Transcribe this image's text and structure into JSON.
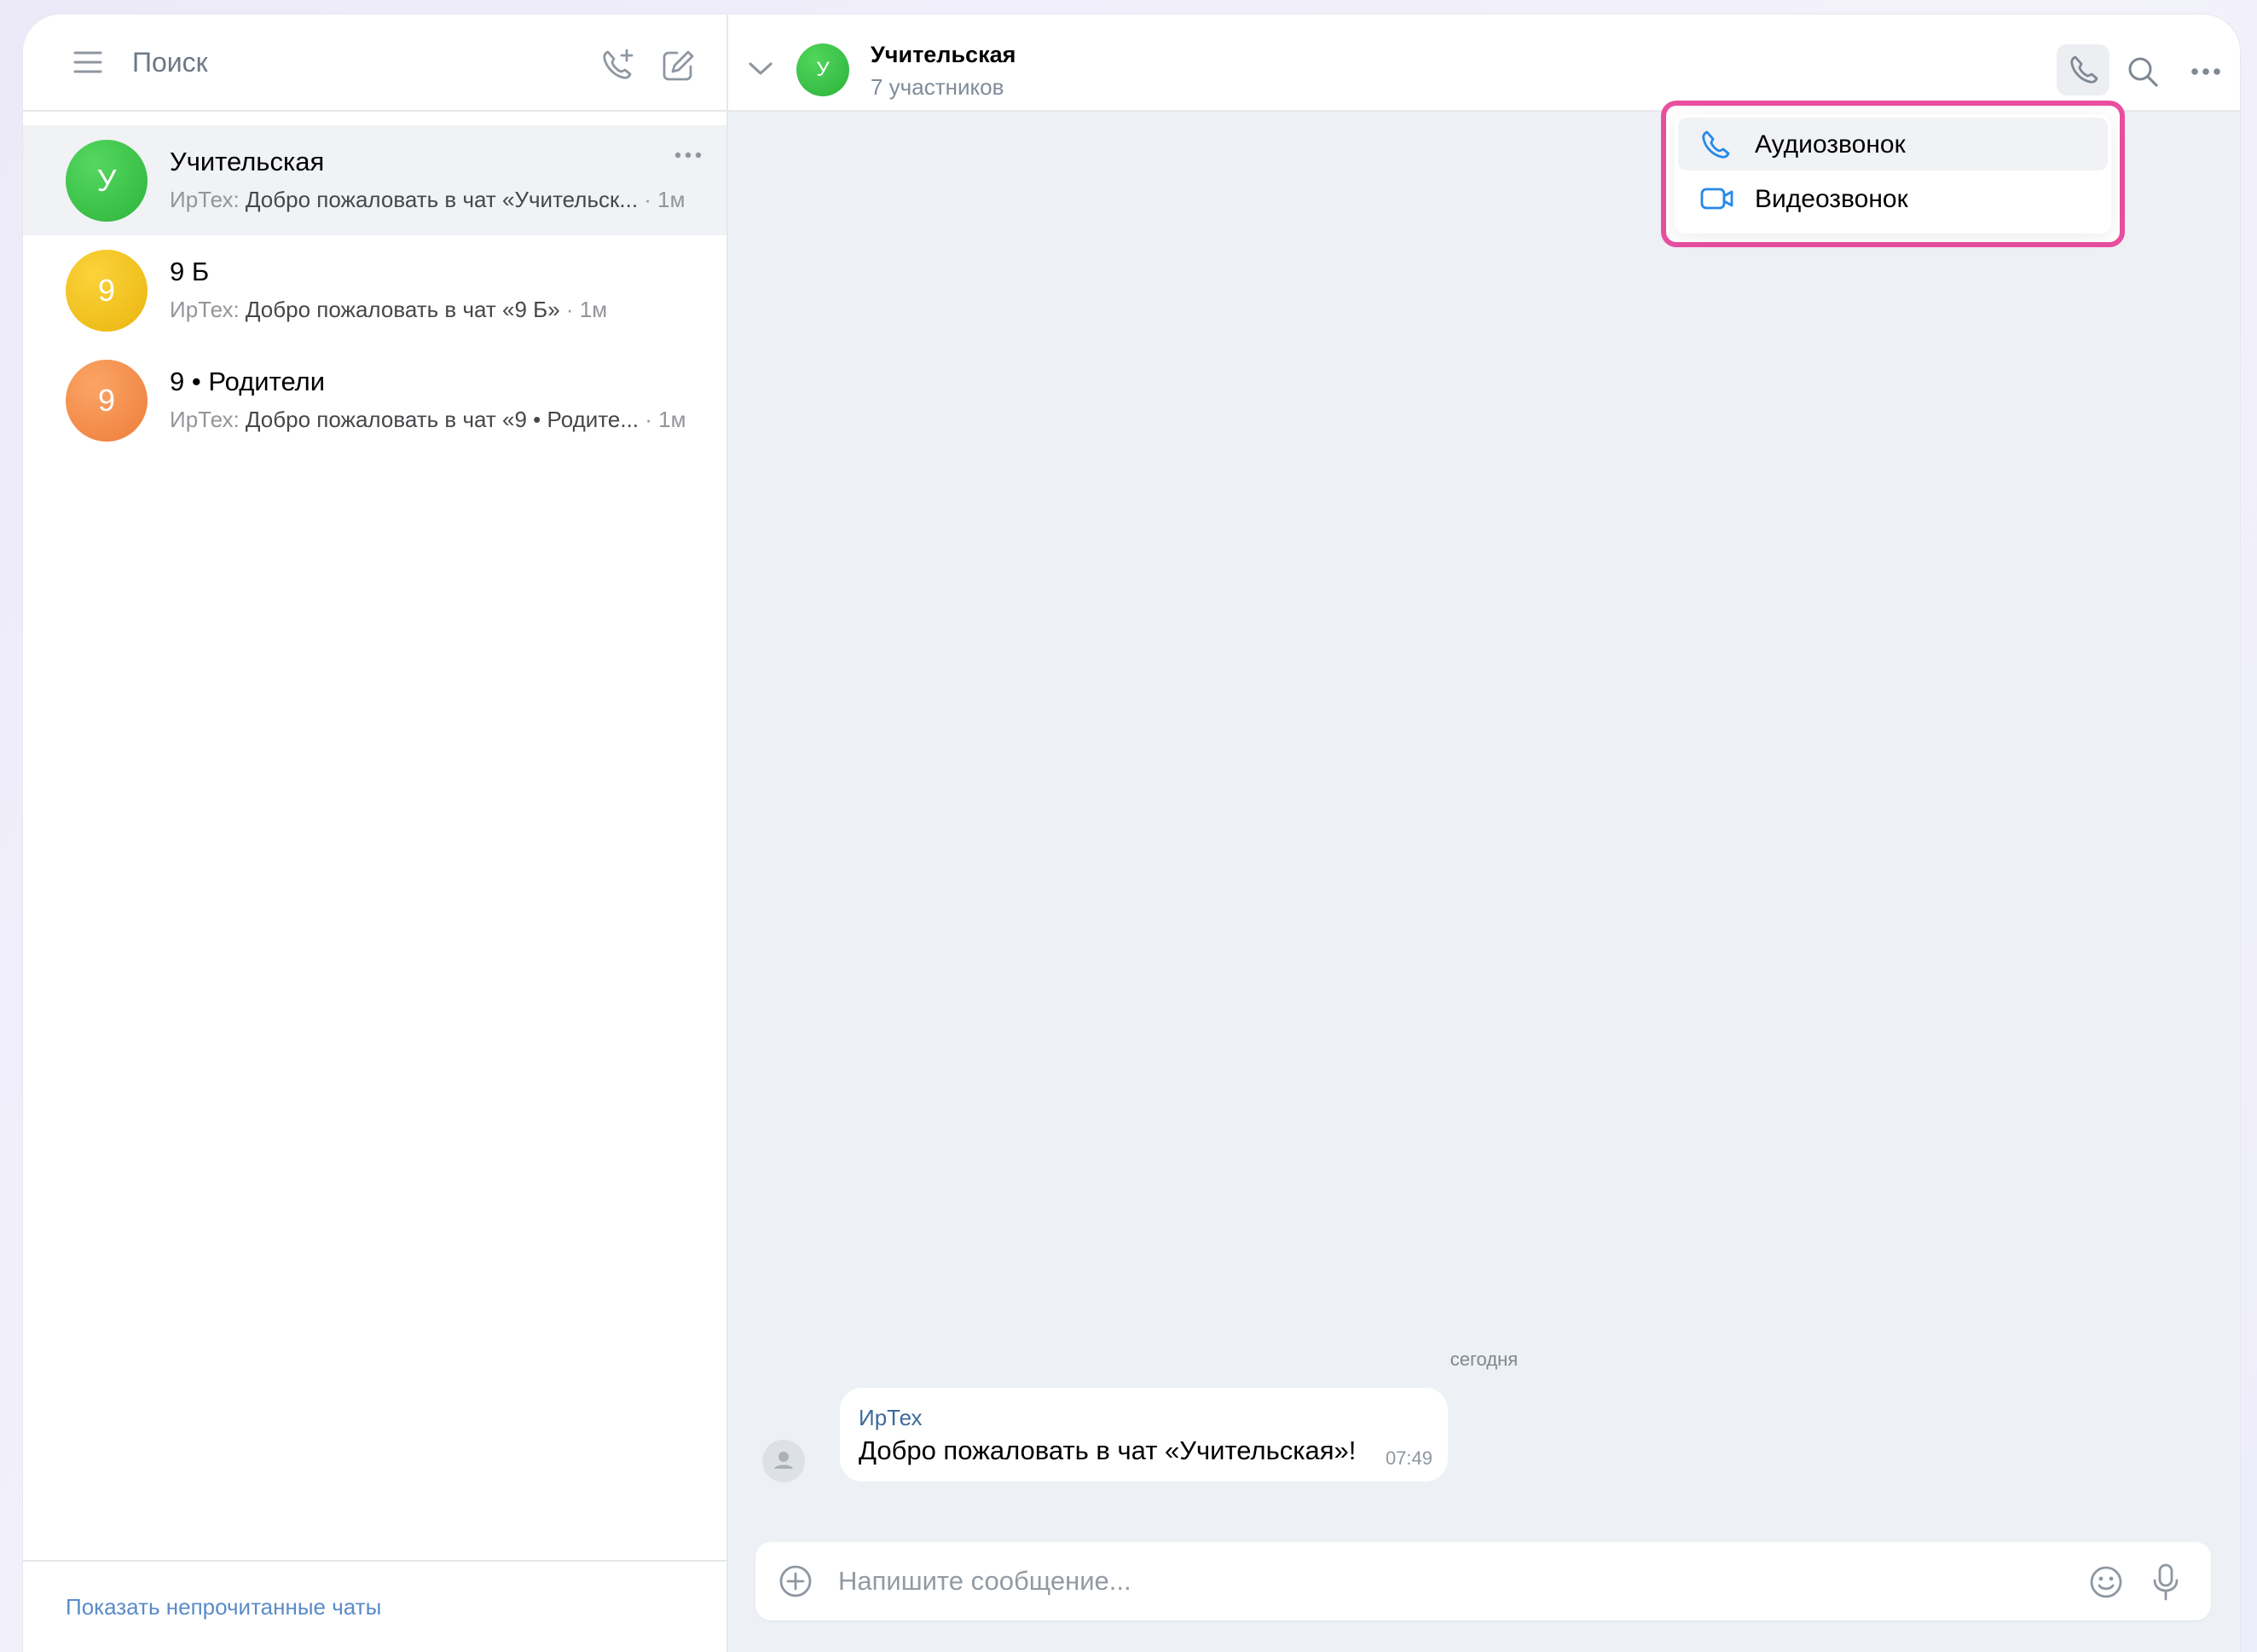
{
  "sidebar": {
    "search_label": "Поиск",
    "chats": [
      {
        "title": "Учительская",
        "avatar_letter": "У",
        "avatar_color": "#39c245",
        "author": "ИрТех:",
        "preview": " Добро пожаловать в чат «Учительск...",
        "time": " · 1м",
        "active": true
      },
      {
        "title": "9 Б",
        "avatar_letter": "9",
        "avatar_color": "#f2bd1c",
        "author": "ИрТех:",
        "preview": " Добро пожаловать в чат «9 Б»",
        "time": " · 1м",
        "active": false
      },
      {
        "title": "9 • Родители",
        "avatar_letter": "9",
        "avatar_color": "#f28b4a",
        "author": "ИрТех:",
        "preview": " Добро пожаловать в чат «9 • Родите...",
        "time": " · 1м",
        "active": false
      }
    ],
    "footer_link": "Показать непрочитанные чаты"
  },
  "header": {
    "avatar_letter": "У",
    "title": "Учительская",
    "subtitle": "7 участников"
  },
  "call_menu": {
    "items": [
      {
        "label": "Аудиозвонок",
        "icon": "phone-icon"
      },
      {
        "label": "Видеозвонок",
        "icon": "video-camera-icon"
      }
    ]
  },
  "messages": {
    "date_separator": "сегодня",
    "items": [
      {
        "author": "ИрТех",
        "text": "Добро пожаловать в чат «Учительская»!",
        "time": "07:49"
      }
    ]
  },
  "composer": {
    "placeholder": "Напишите сообщение..."
  },
  "colors": {
    "accent_blue": "#2688eb",
    "highlight_pink": "#e84f9f"
  }
}
